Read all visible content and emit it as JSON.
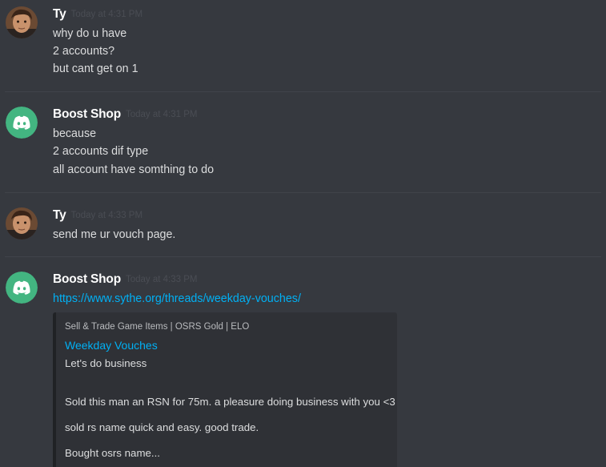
{
  "messages": [
    {
      "username": "Ty",
      "timestamp": "Today at 4:31 PM",
      "avatar": "user-photo-avatar",
      "lines": [
        "why do u have",
        "2 accounts?",
        "but cant get on 1"
      ]
    },
    {
      "username": "Boost Shop",
      "timestamp": "Today at 4:31 PM",
      "avatar": "discord-logo-avatar",
      "lines": [
        "because",
        "2 accounts dif type",
        "all account have somthing to do"
      ]
    },
    {
      "username": "Ty",
      "timestamp": "Today at 4:33 PM",
      "avatar": "user-photo-avatar",
      "lines": [
        "send me ur vouch page."
      ]
    },
    {
      "username": "Boost Shop",
      "timestamp": "Today at 4:33 PM",
      "avatar": "discord-logo-avatar",
      "link": "https://www.sythe.org/threads/weekday-vouches/",
      "embed": {
        "provider": "Sell & Trade Game Items | OSRS Gold | ELO",
        "title": "Weekday Vouches",
        "description": [
          "Let's do business",
          "Sold this man an RSN for 75m. a pleasure doing business with you <3",
          "sold rs name quick and easy. good trade.",
          "Bought osrs name..."
        ]
      }
    }
  ],
  "colors": {
    "background": "#36393f",
    "link": "#00b0f4",
    "discord_avatar": "#43b581"
  }
}
